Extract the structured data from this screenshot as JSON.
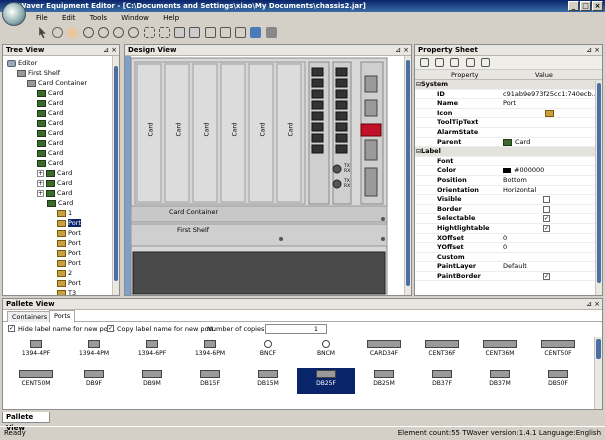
{
  "app": {
    "title": "TWaver Equipment Editor - [C:\\Documents and Settings\\xiao\\My Documents\\chassis2.jar]"
  },
  "menu": [
    "File",
    "Edit",
    "Tools",
    "Window",
    "Help"
  ],
  "tree_view": {
    "title": "Tree View",
    "items": [
      {
        "label": "Editor",
        "level": 0,
        "icon": "editor"
      },
      {
        "label": "First Shelf",
        "level": 1,
        "icon": "cont"
      },
      {
        "label": "Card Container",
        "level": 2,
        "icon": "cont"
      },
      {
        "label": "Card",
        "level": 3,
        "icon": "card"
      },
      {
        "label": "Card",
        "level": 3,
        "icon": "card"
      },
      {
        "label": "Card",
        "level": 3,
        "icon": "card"
      },
      {
        "label": "Card",
        "level": 3,
        "icon": "card"
      },
      {
        "label": "Card",
        "level": 3,
        "icon": "card"
      },
      {
        "label": "Card",
        "level": 3,
        "icon": "card"
      },
      {
        "label": "Card",
        "level": 3,
        "icon": "card"
      },
      {
        "label": "Card",
        "level": 3,
        "icon": "card"
      },
      {
        "label": "Card",
        "level": 3,
        "icon": "card",
        "exp": true
      },
      {
        "label": "Card",
        "level": 3,
        "icon": "card",
        "exp": true
      },
      {
        "label": "Card",
        "level": 3,
        "icon": "card",
        "exp": true
      },
      {
        "label": "Card",
        "level": 4,
        "icon": "card"
      },
      {
        "label": "1",
        "level": 5,
        "icon": "port"
      },
      {
        "label": "Port",
        "level": 5,
        "icon": "port",
        "selected": true
      },
      {
        "label": "Port",
        "level": 5,
        "icon": "port"
      },
      {
        "label": "Port",
        "level": 5,
        "icon": "port"
      },
      {
        "label": "Port",
        "level": 5,
        "icon": "port"
      },
      {
        "label": "Port",
        "level": 5,
        "icon": "port"
      },
      {
        "label": "2",
        "level": 5,
        "icon": "port"
      },
      {
        "label": "Port",
        "level": 5,
        "icon": "port"
      },
      {
        "label": "T3",
        "level": 5,
        "icon": "port"
      }
    ]
  },
  "design_view": {
    "title": "Design View",
    "card_labels": [
      "Card",
      "Card",
      "Card",
      "Card",
      "Card",
      "Card"
    ],
    "card_container_label": "Card Container",
    "shelf_label": "First Shelf",
    "tx_labels": [
      "TX",
      "RX",
      "TX",
      "RX"
    ]
  },
  "property_sheet": {
    "title": "Property Sheet",
    "col_property": "Property",
    "col_value": "Value",
    "rows": [
      {
        "key": "System",
        "cat": true
      },
      {
        "key": "ID",
        "value": "c91ab9e973f25cc1:740ecb..."
      },
      {
        "key": "Name",
        "value": "Port"
      },
      {
        "key": "Icon",
        "value": ""
      },
      {
        "key": "ToolTipText",
        "value": ""
      },
      {
        "key": "AlarmState",
        "value": ""
      },
      {
        "key": "Parent",
        "value": "Card"
      },
      {
        "key": "Label",
        "cat": true
      },
      {
        "key": "Font",
        "value": ""
      },
      {
        "key": "Color",
        "value": "#000000"
      },
      {
        "key": "Position",
        "value": "Bottom"
      },
      {
        "key": "Orientation",
        "value": "Horizontal"
      },
      {
        "key": "Visible",
        "check": false
      },
      {
        "key": "Border",
        "check": false
      },
      {
        "key": "Selectable",
        "check": true
      },
      {
        "key": "Hightlightable",
        "check": true
      },
      {
        "key": "XOffset",
        "value": "0"
      },
      {
        "key": "YOffset",
        "value": "0"
      },
      {
        "key": "Custom",
        "value": ""
      },
      {
        "key": "PaintLayer",
        "value": "Default"
      },
      {
        "key": "PaintBorder",
        "check": true
      }
    ]
  },
  "pallete": {
    "title": "Pallete View",
    "tabs": [
      "Containers",
      "Ports"
    ],
    "hide_label": "Hide label name for new port.",
    "copy_label": "Copy label name for new port.",
    "copies_label": "Number of copies:",
    "copies_value": "1",
    "items": [
      "1394-4PF",
      "1394-4PM",
      "1394-6PF",
      "1394-6PM",
      "BNCF",
      "BNCM",
      "CARD34F",
      "CENT36F",
      "CENT36M",
      "CENT50F",
      "CENT50M",
      "DB9F",
      "DB9M",
      "DB15F",
      "DB15M",
      "DB25F",
      "DB25M",
      "DB37F",
      "DB37M",
      "DB50F"
    ],
    "selected_item": "DB25F"
  },
  "bottom_tab": "Pallete View",
  "status": {
    "left": "Ready",
    "right": "Element count:55 TWaver version:1.4.1 Language:English"
  }
}
